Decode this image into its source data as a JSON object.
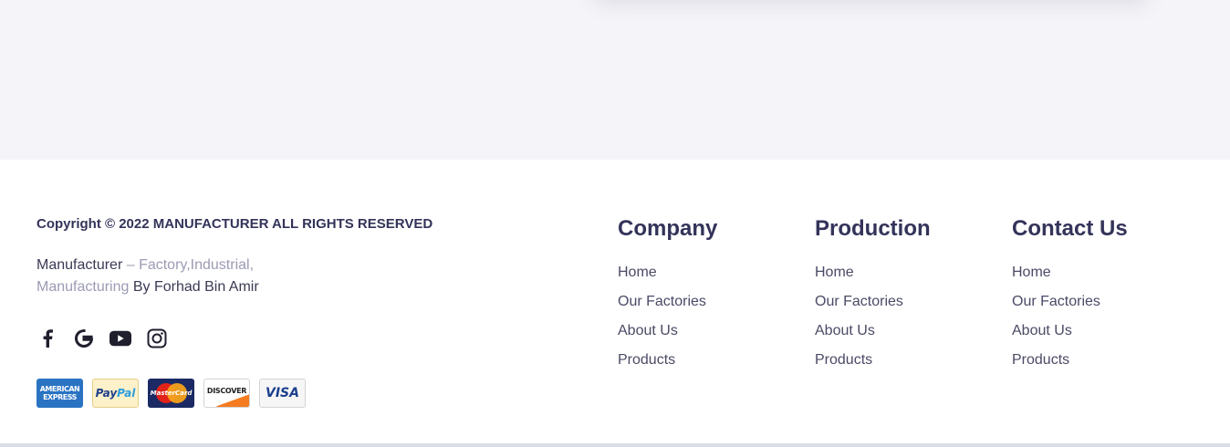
{
  "footer": {
    "copyright": "Copyright © 2022 MANUFACTURER ALL RIGHTS RESERVED",
    "tagline": {
      "brand": "Manufacturer",
      "sep": " – ",
      "desc": "Factory,Industrial, Manufacturing",
      "by": " By Forhad Bin Amir"
    },
    "social_icons": [
      "facebook-icon",
      "google-icon",
      "youtube-icon",
      "instagram-icon"
    ],
    "payments": {
      "amex": "AMERICAN EXPRESS",
      "paypal_a": "Pay",
      "paypal_b": "Pal",
      "mastercard": "MasterCard",
      "discover": "DISCOVER",
      "visa": "VISA"
    },
    "columns": [
      {
        "title": "Company",
        "links": [
          "Home",
          "Our Factories",
          "About Us",
          "Products"
        ]
      },
      {
        "title": "Production",
        "links": [
          "Home",
          "Our Factories",
          "About Us",
          "Products"
        ]
      },
      {
        "title": "Contact Us",
        "links": [
          "Home",
          "Our Factories",
          "About Us",
          "Products"
        ]
      }
    ]
  },
  "colors": {
    "heading": "#33335a",
    "muted": "#9b9bb4",
    "top_band": "#f5f5f9"
  }
}
